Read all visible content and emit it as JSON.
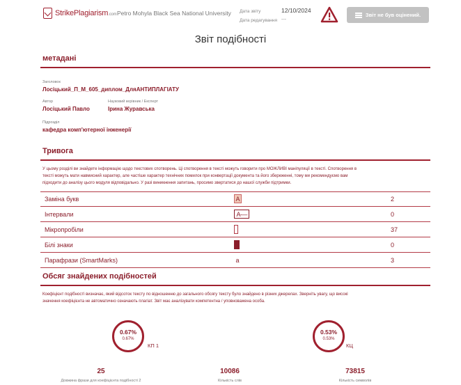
{
  "header": {
    "brand_name": "StrikePlagiarism",
    "brand_suffix": ".com",
    "university": "Petro Mohyla Black Sea National University",
    "date_label": "Дата звіту",
    "date_value": "12/10/2024",
    "edit_date_label": "Дата редагування",
    "edit_date_value": "---",
    "warning_icon": "warning-triangle-icon",
    "not_rated_label": "Звіт не був оцінений."
  },
  "report_title": "Звіт подібності",
  "metadata": {
    "section_title": "метадані",
    "title_label": "Заголовок",
    "title_value": "Лосіцький_П_М_605_диплом_ДляАНТИПЛАГІАТУ",
    "author_label": "Автор",
    "author_value": "Лосіцький Павло",
    "supervisor_label": "Науковий керівник / Експерт",
    "supervisor_value": "Ірина Журавська",
    "unit_label": "Підрозділ",
    "unit_value": "кафедра комп'ютерної інженерії"
  },
  "alarm": {
    "section_title": "Тривога",
    "description_line1": "У цьому розділі ви знайдете інформацію щодо текстових спотворень. Ці спотворення в тексті можуть говорити про МОЖЛИВІ маніпуляції в тексті. Спотворення в",
    "description_line2": "тексті можуть мати навмисний характер, але частіше характер технічних помилок при конвертації документа та його збереженні, тому ми рекомендуємо вам",
    "description_line3": "підходити до аналізу цього модуля відповідально. У разі виникнення запитань, просимо звертатися до нашої служби підтримки.",
    "rows": [
      {
        "name": "Заміна букв",
        "symbol": "A",
        "count": "2"
      },
      {
        "name": "Інтервали",
        "symbol": "A·—",
        "count": "0"
      },
      {
        "name": "Мікропробіли",
        "symbol": "",
        "count": "37"
      },
      {
        "name": "Білі знаки",
        "symbol": "",
        "count": "0"
      },
      {
        "name": "Парафрази (SmartMarks)",
        "symbol": "a",
        "count": "3"
      }
    ]
  },
  "similarity": {
    "section_title": "Обсяг знайдених подібностей",
    "description_line1": "Коефіцієнт подібності визначає, який відсоток тексту по відношенню до загального обсягу тексту було знайдено в різних джерелах. Зверніть увагу, що високі",
    "description_line2": "значення коефіцієнта не автоматично означають плагіат. Звіт має аналізувати компетентна / уповноважена особа.",
    "kp1": {
      "value": "0.67%",
      "sub": "0.67%",
      "label": "КП 1"
    },
    "kc": {
      "value": "0.53%",
      "sub": "0.53%",
      "label": "КЦ"
    },
    "stats": [
      {
        "value": "25",
        "caption": "Довжина фрази для коефіцієнта подібності 2"
      },
      {
        "value": "10086",
        "caption": "Кількість слів"
      },
      {
        "value": "73815",
        "caption": "Кількість символів"
      }
    ]
  },
  "colors": {
    "accent": "#a0202e",
    "text_accent": "#8b1e2b",
    "button_disabled": "#c2c2c2"
  }
}
